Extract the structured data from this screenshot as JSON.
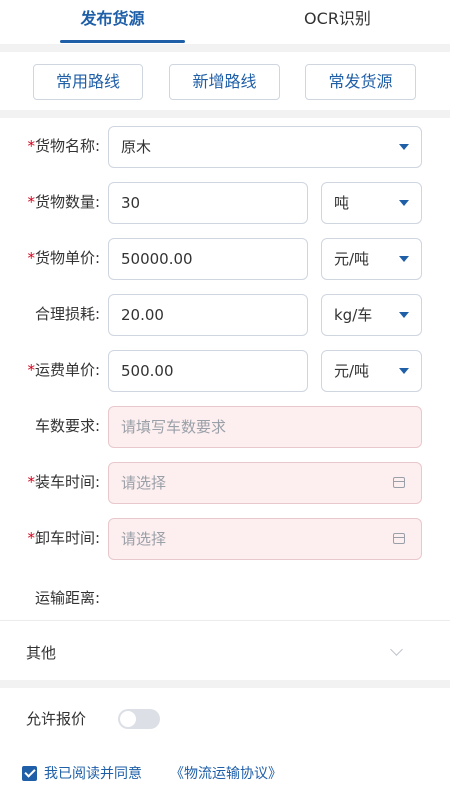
{
  "tabs": [
    {
      "label": "发布货源",
      "active": true
    },
    {
      "label": "OCR识别",
      "active": false
    }
  ],
  "route_buttons": [
    "常用路线",
    "新增路线",
    "常发货源"
  ],
  "form": {
    "required_mark": "*",
    "cargo_name": {
      "label": "货物名称:",
      "value": "原木",
      "required": true
    },
    "cargo_qty": {
      "label": "货物数量:",
      "value": "30",
      "unit": "吨",
      "required": true
    },
    "cargo_price": {
      "label": "货物单价:",
      "value": "50000.00",
      "unit": "元/吨",
      "required": true
    },
    "loss": {
      "label": "合理损耗:",
      "value": "20.00",
      "unit": "kg/车",
      "required": false
    },
    "freight_price": {
      "label": "运费单价:",
      "value": "500.00",
      "unit": "元/吨",
      "required": true
    },
    "vehicle_req": {
      "label": "车数要求:",
      "placeholder": "请填写车数要求",
      "required": false
    },
    "load_time": {
      "label": "装车时间:",
      "placeholder": "请选择",
      "required": true
    },
    "unload_time": {
      "label": "卸车时间:",
      "placeholder": "请选择",
      "required": true
    },
    "distance": {
      "label": "运输距离:"
    }
  },
  "other": {
    "label": "其他"
  },
  "allow_quote": {
    "label": "允许报价",
    "on": false
  },
  "agreement": {
    "text": "我已阅读并同意",
    "link": "《物流运输协议》",
    "checked": true
  },
  "colors": {
    "accent": "#1f5fa8",
    "required": "#d9001b",
    "pink_field": "#fdeff0"
  }
}
